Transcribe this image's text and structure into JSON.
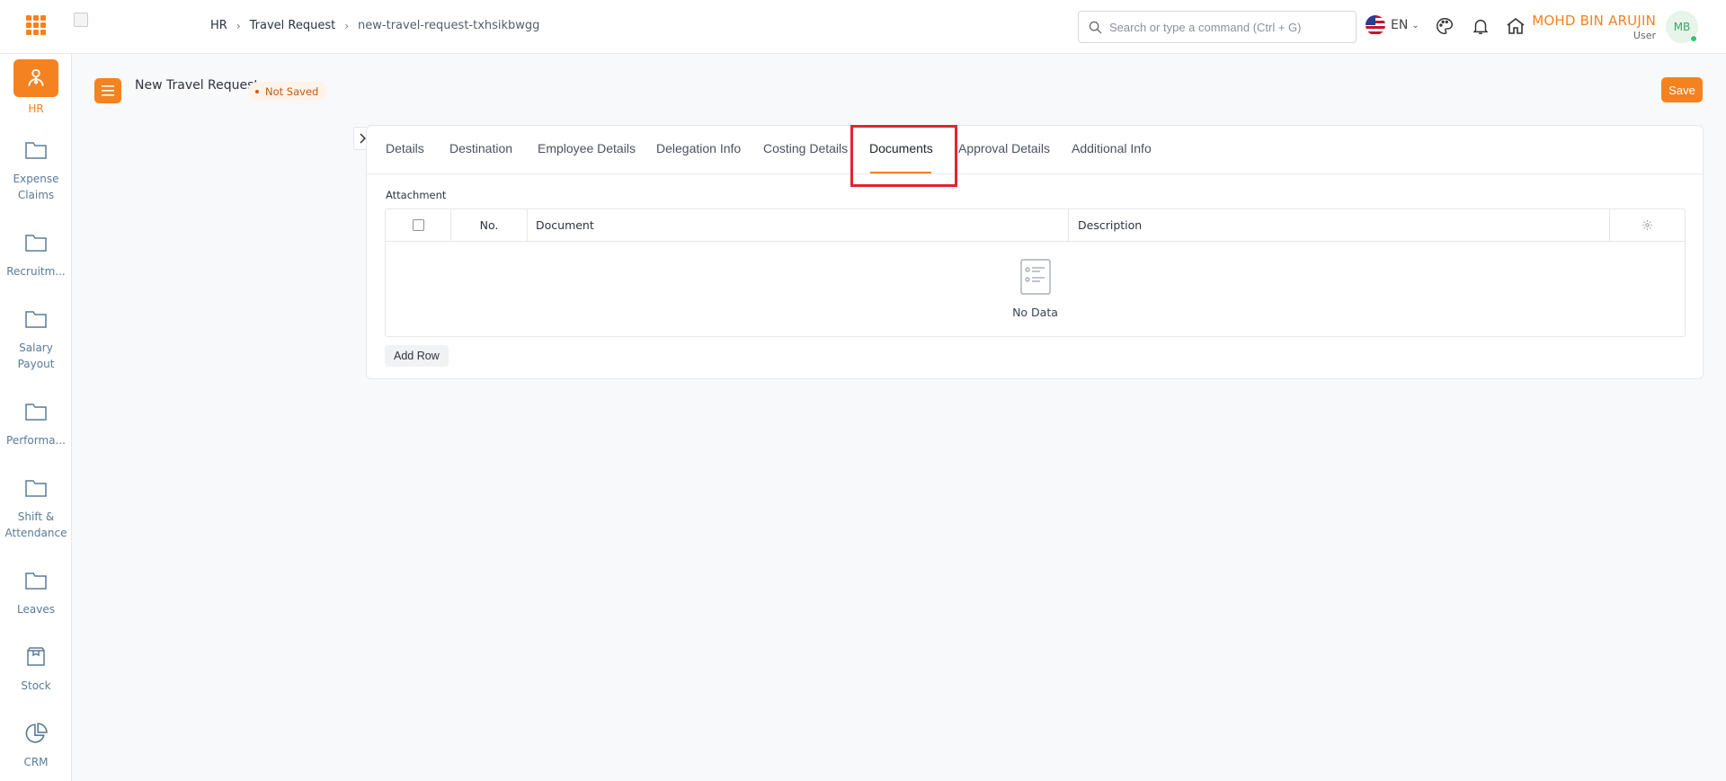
{
  "header": {
    "breadcrumb": [
      "HR",
      "Travel Request",
      "new-travel-request-txhsikbwgg"
    ],
    "search_placeholder": "Search or type a command (Ctrl + G)",
    "language": "EN",
    "user_name": "MOHD BIN ARUJIN",
    "user_role": "User",
    "avatar_initials": "MB"
  },
  "sidebar": {
    "items": [
      {
        "label": "HR",
        "icon": "hr-icon",
        "active": true
      },
      {
        "label": "Expense Claims",
        "icon": "folder-icon"
      },
      {
        "label": "Recruitm...",
        "icon": "folder-icon"
      },
      {
        "label": "Salary Payout",
        "icon": "folder-icon"
      },
      {
        "label": "Performa...",
        "icon": "folder-icon"
      },
      {
        "label": "Shift & Attendance",
        "icon": "folder-icon"
      },
      {
        "label": "Leaves",
        "icon": "folder-icon"
      },
      {
        "label": "Stock",
        "icon": "box-icon"
      },
      {
        "label": "CRM",
        "icon": "pie-chart-icon"
      }
    ]
  },
  "page": {
    "title": "New Travel Request",
    "status": "Not Saved",
    "save_label": "Save"
  },
  "tabs": [
    "Details",
    "Destination",
    "Employee Details",
    "Delegation Info",
    "Costing Details",
    "Documents",
    "Approval Details",
    "Additional Info"
  ],
  "active_tab": "Documents",
  "attachment": {
    "label": "Attachment",
    "columns": {
      "no": "No.",
      "document": "Document",
      "description": "Description"
    },
    "empty_text": "No Data",
    "add_row_label": "Add Row"
  },
  "colors": {
    "accent": "#f58220",
    "highlight": "#e0252f",
    "sidebar_text": "#5a7b97"
  }
}
